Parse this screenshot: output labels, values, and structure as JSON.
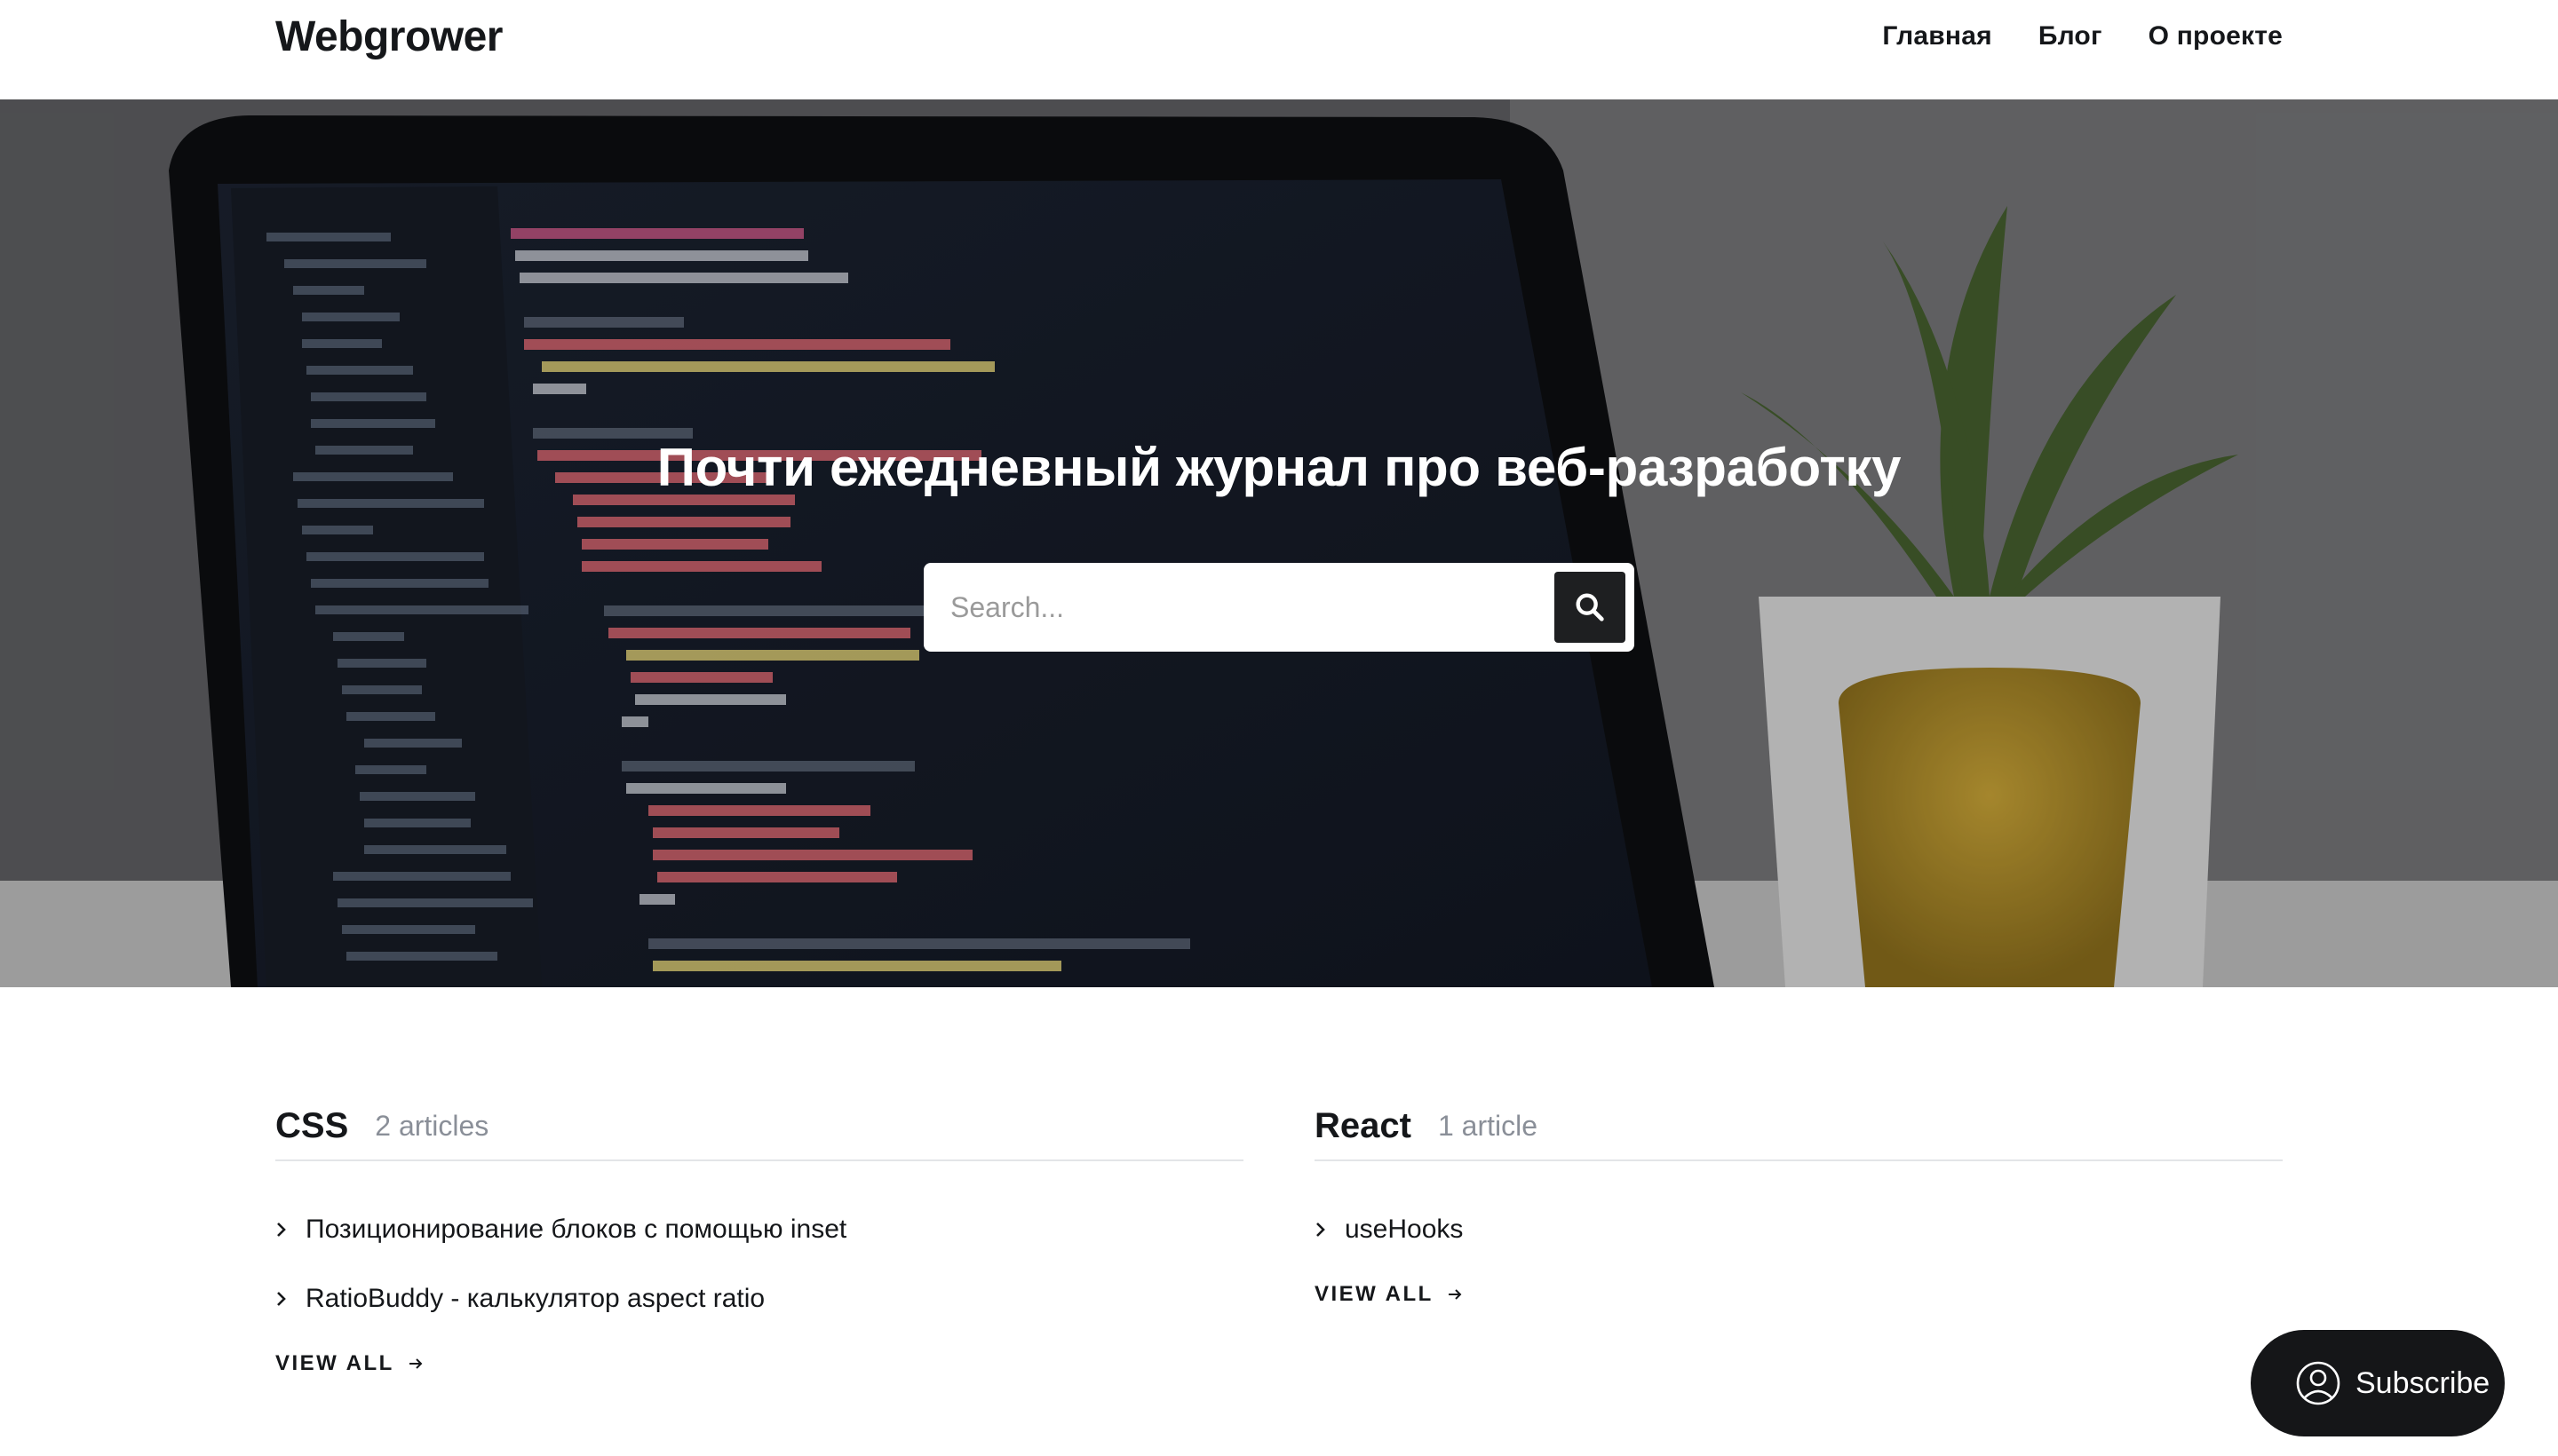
{
  "header": {
    "logo": "Webgrower",
    "nav": [
      "Главная",
      "Блог",
      "О проекте"
    ]
  },
  "hero": {
    "title": "Почти ежедневный журнал про веб-разработку",
    "search_placeholder": "Search...",
    "search_icon": "search-icon",
    "background": "laptop-code-and-plant-photo"
  },
  "topics": [
    {
      "name": "CSS",
      "count": "2 articles",
      "posts": [
        "Позиционирование блоков с помощью inset",
        "RatioBuddy - калькулятор aspect ratio"
      ],
      "view_all": "VIEW ALL"
    },
    {
      "name": "React",
      "count": "1 article",
      "posts": [
        "useHooks"
      ],
      "view_all": "VIEW ALL"
    }
  ],
  "subscribe": {
    "label": "Subscribe",
    "icon": "user-icon"
  },
  "colors": {
    "text": "#15171a",
    "muted": "#8a8f98",
    "button_dark": "#151618"
  }
}
